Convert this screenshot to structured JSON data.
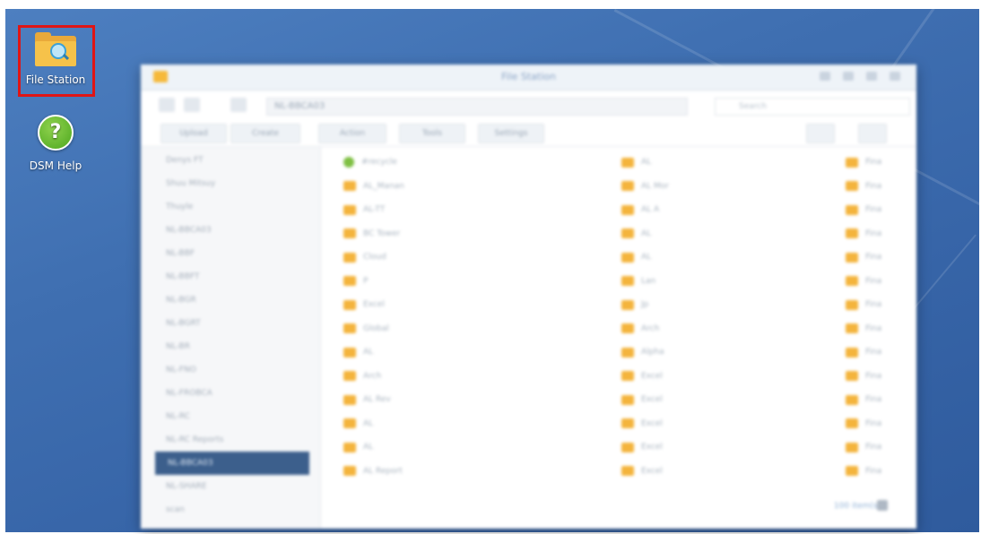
{
  "desktop_icons": [
    {
      "label": "File Station",
      "icon": "folder-search-icon"
    },
    {
      "label": "DSM Help",
      "icon": "help-icon",
      "glyph": "?"
    }
  ],
  "window": {
    "title": "File Station",
    "path": "NL-BBCA03",
    "search_placeholder": "Search",
    "toolbar": [
      "Upload",
      "Create",
      "Action",
      "Tools",
      "Settings"
    ],
    "status": "100 item(s)"
  },
  "sidebar_items": [
    "Denys FT",
    "Shuu Mitsuy",
    "Thuyle",
    "NL-BBCA03",
    "NL-BBF",
    "NL-BBFT",
    "NL-BGR",
    "NL-BGRT",
    "NL-BR",
    "NL-FNO",
    "NL-FROBCA",
    "NL-RC",
    "NL-RC Reports",
    "NL-BBCA03",
    "NL-SHARE",
    "scan"
  ],
  "selected_sidebar_index": 13,
  "files_col1": [
    "#recycle",
    "AL_Manan",
    "AL-TT",
    "BC Tower",
    "Cloud",
    "P",
    "Excel",
    "Global",
    "AL",
    "Arch",
    "AL Rev",
    "AL",
    "AL",
    "AL Report"
  ],
  "files_col2": [
    "AL",
    "AL Mor",
    "AL A",
    "AL",
    "AL",
    "Lan",
    "Jp",
    "Arch",
    "Alpha",
    "Excel",
    "Excel",
    "Excel",
    "Excel",
    "Excel"
  ],
  "files_col3": [
    "Fina",
    "Fina",
    "Fina",
    "Fina",
    "Fina",
    "Fina",
    "Fina",
    "Fina",
    "Fina",
    "Fina",
    "Fina",
    "Fina",
    "Fina",
    "Fina"
  ],
  "colors": {
    "highlight": "#e01515",
    "folder": "#f4b43c",
    "selected": "#3c5f8c"
  }
}
